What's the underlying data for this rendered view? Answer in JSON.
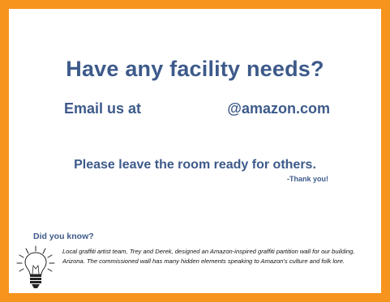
{
  "sign": {
    "title": "Have any facility needs?",
    "email_prefix": "Email us at",
    "email_domain": "@amazon.com",
    "instruction": "Please leave the room ready for others.",
    "thanks": "-Thank you!"
  },
  "did_you_know": {
    "heading": "Did you know?",
    "text": "Local graffiti artist team, Trey and Derek, designed an Amazon-inspired graffiti partition wall for our building, Arizona. The commissioned wall has many hidden elements speaking to Amazon's culture and folk lore.",
    "icon": "lightbulb-icon"
  },
  "colors": {
    "border": "#F7941D",
    "heading_text": "#3D5A8A"
  }
}
